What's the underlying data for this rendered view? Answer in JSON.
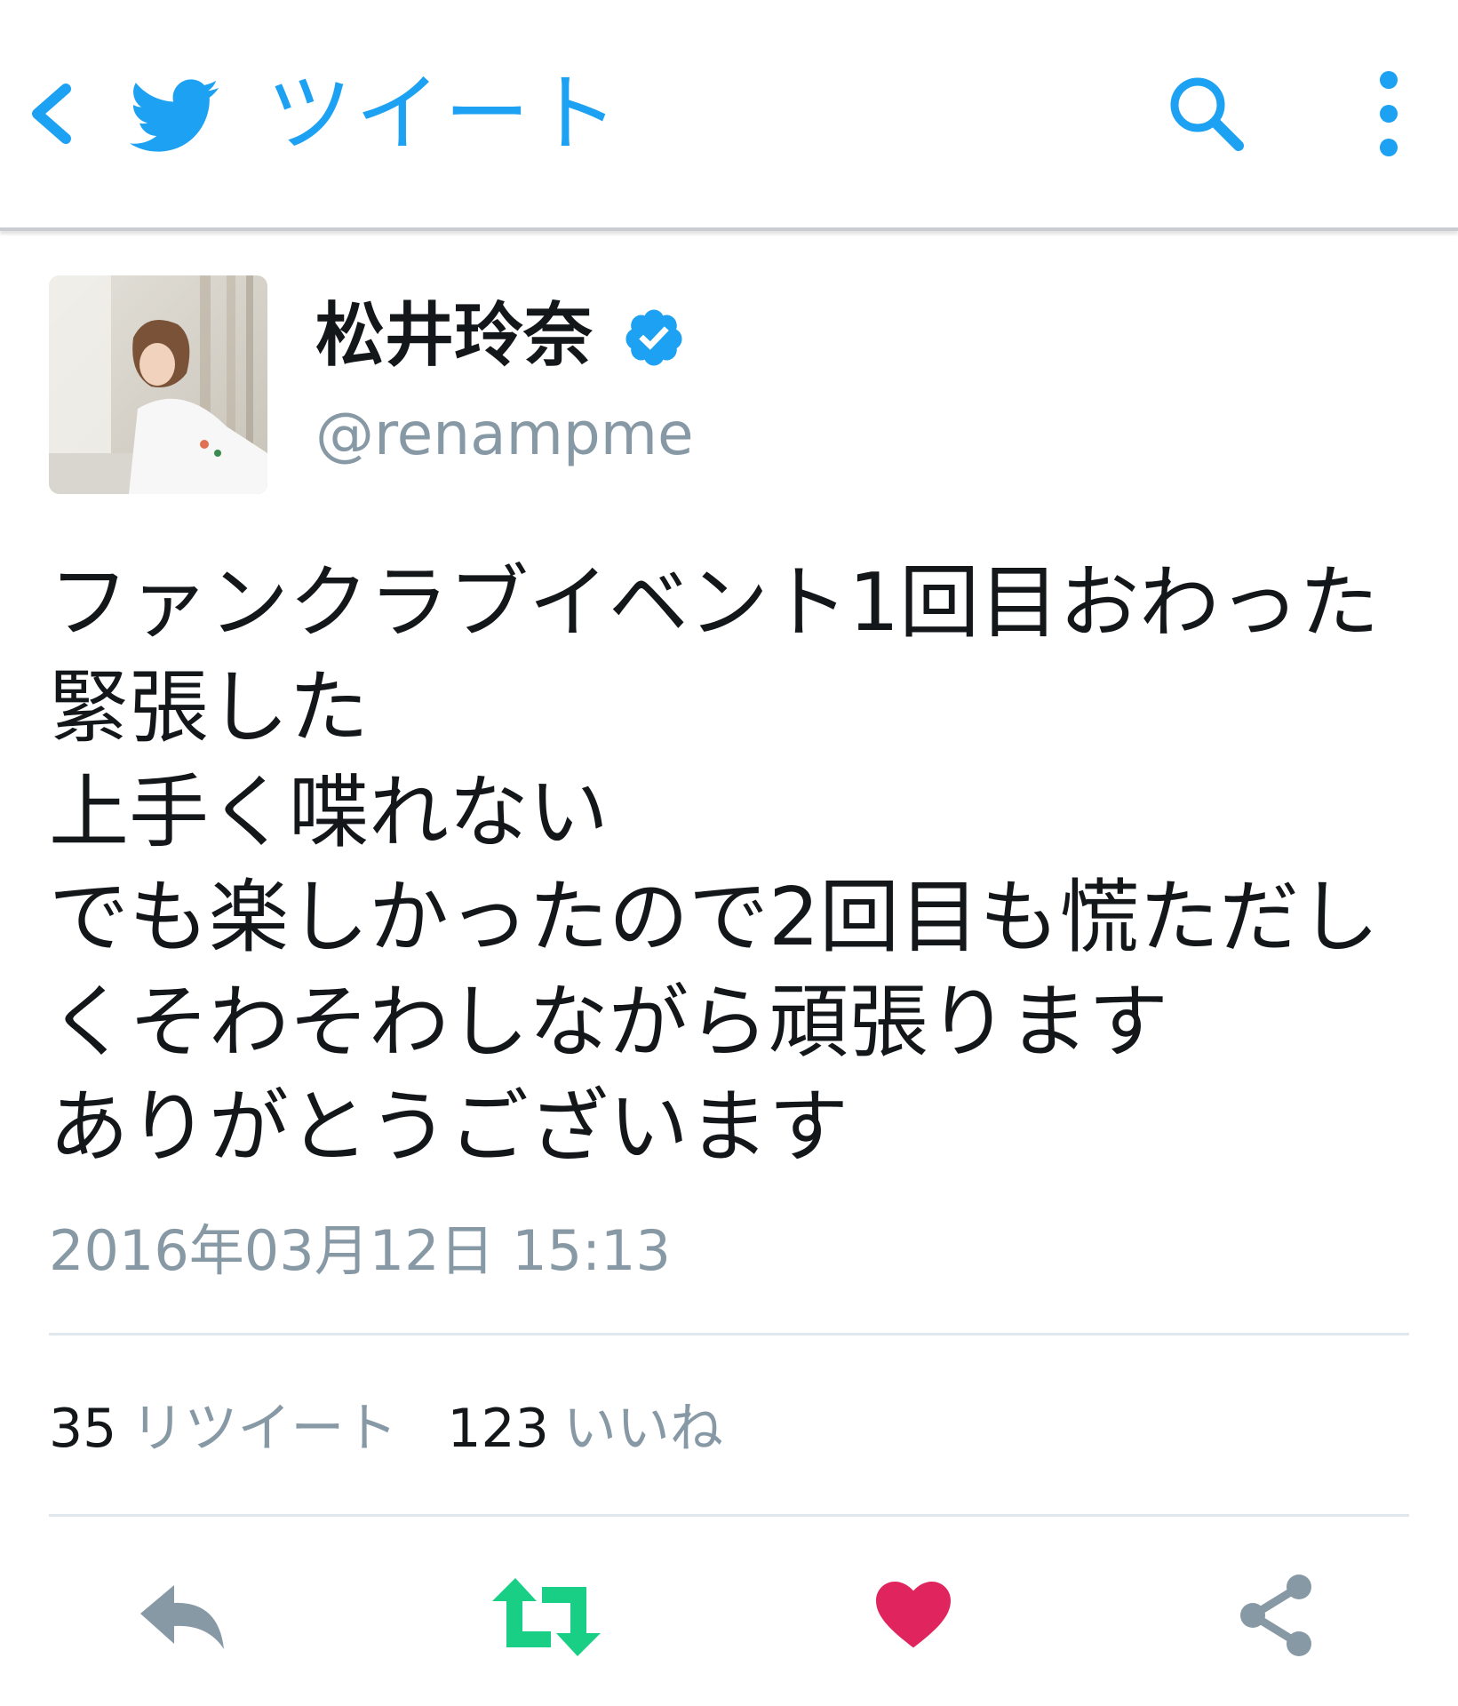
{
  "header": {
    "title": "ツイート",
    "back_icon": "chevron-left-icon",
    "logo_icon": "twitter-bird-icon",
    "search_icon": "search-icon",
    "more_icon": "more-vertical-icon",
    "accent_color": "#1da1f2"
  },
  "tweet": {
    "author": {
      "display_name": "松井玲奈",
      "handle": "@renampme",
      "verified": true,
      "verified_icon": "verified-badge-icon"
    },
    "text_lines": [
      "ファンクラブイベント1回目おわった",
      "緊張した",
      "上手く喋れない",
      "でも楽しかったので2回目も慌ただし",
      "くそわそわしながら頑張ります",
      "ありがとうございます"
    ],
    "timestamp": "2016年03月12日 15:13"
  },
  "stats": {
    "retweet_count": "35",
    "retweet_label": "リツイート",
    "like_count": "123",
    "like_label": "いいね"
  },
  "actions": {
    "reply_icon": "reply-icon",
    "retweet_icon": "retweet-icon",
    "retweet_color": "#19cf86",
    "like_icon": "heart-icon",
    "like_color": "#e0245e",
    "share_icon": "share-icon"
  }
}
